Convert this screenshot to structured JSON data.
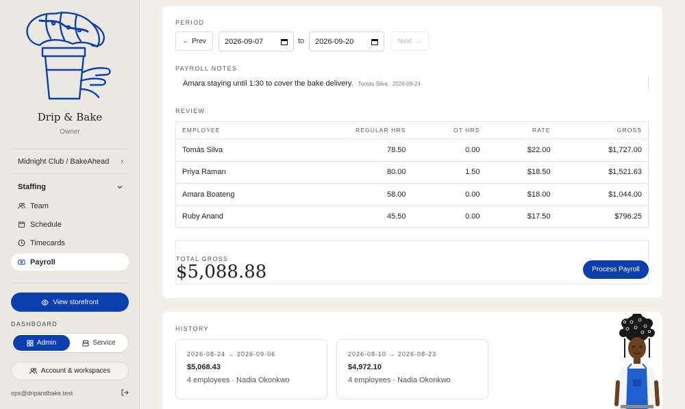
{
  "sidebar": {
    "brand": "Drip & Bake",
    "role": "Owner",
    "workspace": "Midnight Club / BakeAhead",
    "section": "Staffing",
    "items": [
      {
        "label": "Team",
        "icon": "team-icon"
      },
      {
        "label": "Schedule",
        "icon": "calendar-icon"
      },
      {
        "label": "Timecards",
        "icon": "clock-icon"
      },
      {
        "label": "Payroll",
        "icon": "payroll-icon",
        "active": true
      }
    ],
    "storefront_label": "View storefront",
    "dashboard_label": "DASHBOARD",
    "toggle": {
      "admin": "Admin",
      "service": "Service",
      "selected": "Admin"
    },
    "account_label": "Account & workspaces",
    "email": "ops@dripandbake.test"
  },
  "period": {
    "label": "PERIOD",
    "prev": "Prev",
    "start": "2026-09-07",
    "to": "to",
    "end": "2026-09-20",
    "next": "Next"
  },
  "notes": {
    "label": "PAYROLL NOTES",
    "text": "Amara staying until 1:30 to cover the bake delivery.",
    "meta": "Tomás Silva · 2026-09-24"
  },
  "review": {
    "label": "REVIEW",
    "columns": [
      "EMPLOYEE",
      "REGULAR HRS",
      "OT HRS",
      "RATE",
      "GROSS"
    ],
    "rows": [
      [
        "Tomás Silva",
        "78.50",
        "0.00",
        "$22.00",
        "$1,727.00"
      ],
      [
        "Priya Raman",
        "80.00",
        "1.50",
        "$18.50",
        "$1,521.63"
      ],
      [
        "Amara Boateng",
        "58.00",
        "0.00",
        "$18.00",
        "$1,044.00"
      ],
      [
        "Ruby Anand",
        "45.50",
        "0.00",
        "$17.50",
        "$796.25"
      ]
    ]
  },
  "total": {
    "label": "TOTAL GROSS",
    "value": "$5,088.88",
    "process_label": "Process Payroll"
  },
  "history": {
    "label": "HISTORY",
    "items": [
      {
        "range": "2026-08-24 → 2026-09-06",
        "total": "$5,068.43",
        "meta": "4 employees · Nadia Okonkwo"
      },
      {
        "range": "2026-08-10 → 2026-08-23",
        "total": "$4,972.10",
        "meta": "4 employees · Nadia Okonkwo"
      }
    ]
  },
  "colors": {
    "accent": "#0b3fb0",
    "sidebar_bg": "#ebe8e2",
    "page_bg": "#f2efe9"
  }
}
